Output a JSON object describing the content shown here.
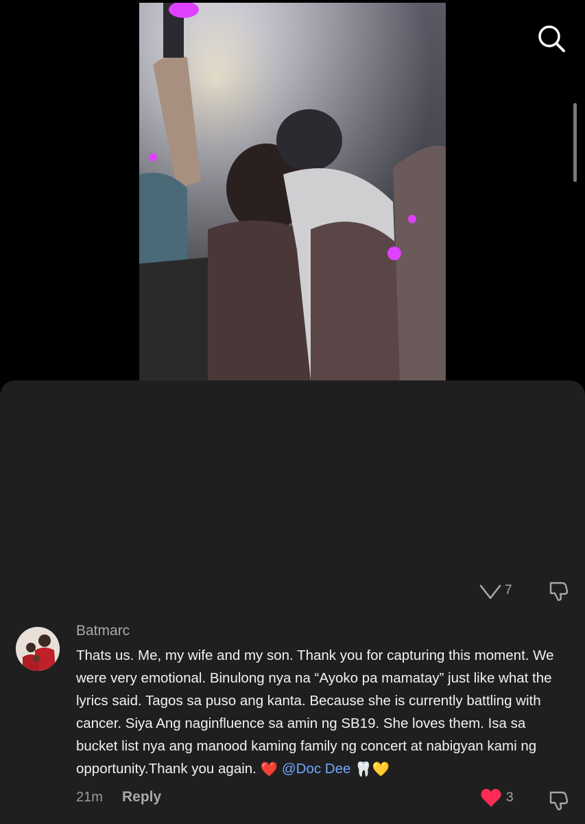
{
  "icons": {
    "search": "search-icon",
    "like_outline": "heart-outline-icon",
    "like_filled": "heart-filled-icon",
    "dislike": "thumbs-down-icon"
  },
  "colors": {
    "background": "#000000",
    "sheet": "#1f1f1f",
    "mention": "#6fa8ff",
    "heart": "#fe2c55"
  },
  "previous_comment": {
    "like_count": "7"
  },
  "comment": {
    "username": "Batmarc",
    "text_main": "Thats us. Me, my wife and my son. Thank you for capturing this moment. We were very emotional. Binulong nya na “Ayoko pa mamatay” just like what the lyrics said. Tagos sa puso ang kanta. Because she is currently battling with cancer. Siya Ang naginfluence sa amin ng SB19. She loves them. Isa sa bucket list nya ang manood kaming family ng concert at nabigyan kami ng opportunity.Thank you again.",
    "emoji_heart": "❤️",
    "mention": "@Doc Dee",
    "emoji_tooth": "🦷",
    "emoji_yellow_heart": "💛",
    "time": "21m",
    "reply_label": "Reply",
    "like_count": "3"
  }
}
